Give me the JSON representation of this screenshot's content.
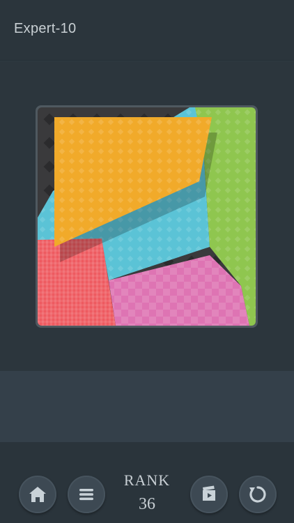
{
  "header": {
    "level_title": "Expert-10"
  },
  "board": {
    "pieces": [
      {
        "name": "dark-background",
        "color": "#3a3a3c"
      },
      {
        "name": "blue-piece",
        "color": "#5bc3d6"
      },
      {
        "name": "green-piece",
        "color": "#8fc64f"
      },
      {
        "name": "pink-piece",
        "color": "#de74b3"
      },
      {
        "name": "red-piece",
        "color": "#ee5a60"
      },
      {
        "name": "yellow-piece",
        "color": "#f1aa2a"
      }
    ]
  },
  "footer": {
    "rank_label": "RANK",
    "rank_value": "36",
    "buttons": [
      {
        "name": "home",
        "icon": "home-icon"
      },
      {
        "name": "menu",
        "icon": "menu-icon"
      },
      {
        "name": "video-hint",
        "icon": "video-icon"
      },
      {
        "name": "restart",
        "icon": "restart-icon"
      }
    ]
  }
}
